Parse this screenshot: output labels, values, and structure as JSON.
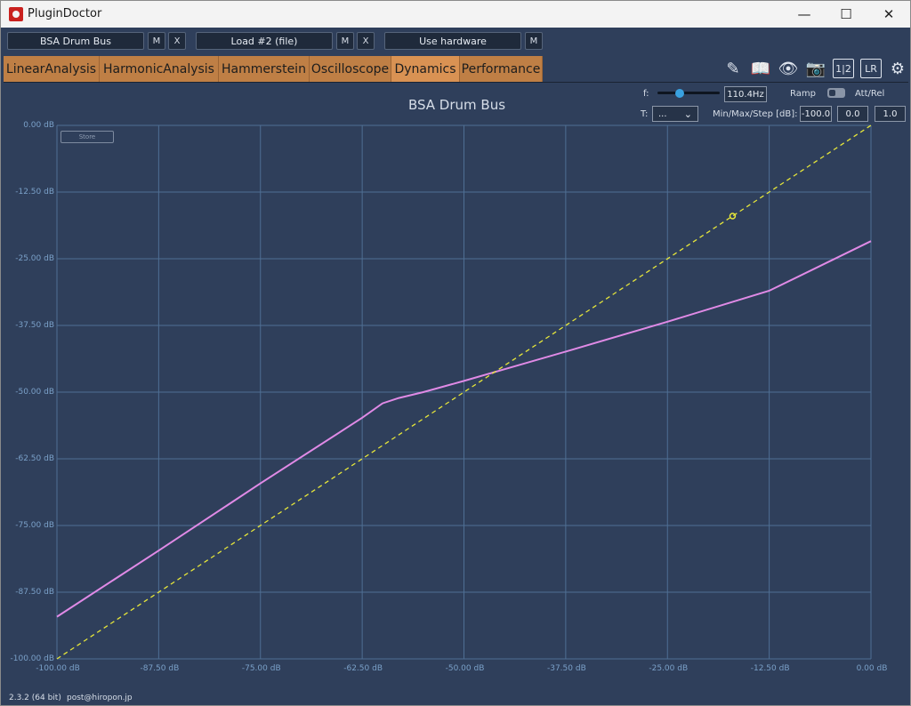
{
  "window": {
    "title": "PluginDoctor",
    "minimize": "—",
    "maximize": "☐",
    "close": "✕"
  },
  "toolbar": {
    "plugin_name": "BSA Drum Bus",
    "plugin_m": "M",
    "plugin_x": "X",
    "load_name": "Load #2 (file)",
    "load_m": "M",
    "load_x": "X",
    "hardware": "Use hardware",
    "hardware_m": "M"
  },
  "tabs": [
    "LinearAnalysis",
    "HarmonicAnalysis",
    "Hammerstein",
    "Oscilloscope",
    "Dynamics",
    "Performance"
  ],
  "active_tab": "Dynamics",
  "tool_icons": [
    "notes-icon",
    "book-icon",
    "eye-icon",
    "camera-icon",
    "split-12-icon",
    "lr-icon",
    "gear-icon"
  ],
  "tool_glyphs": [
    "✎",
    "📖",
    "👁",
    "📷",
    "1|2",
    "LR",
    "⚙"
  ],
  "controls": {
    "f_label": "f:",
    "f_value": "110.4Hz",
    "ramp_label": "Ramp",
    "attrel_label": "Att/Rel",
    "t_label": "T:",
    "t_value": "...",
    "minmax_label": "Min/Max/Step [dB]:",
    "min_value": "-100.0",
    "max_value": "0.0",
    "step_value": "1.0"
  },
  "store_label": "Store",
  "status": {
    "version": "2.3.2 (64 bit)",
    "email": "post@hiropon.jp"
  },
  "colors": {
    "background": "#2f3f5b",
    "grid": "#4f6f94",
    "curve": "#e08ae6",
    "reference": "#e6e63a",
    "tab": "#bf7f45"
  },
  "chart_data": {
    "type": "line",
    "title": "BSA Drum Bus",
    "xlim": [
      -100,
      0
    ],
    "ylim": [
      -100,
      0
    ],
    "x_ticks": [
      "-100.00 dB",
      "-87.50 dB",
      "-75.00 dB",
      "-62.50 dB",
      "-50.00 dB",
      "-37.50 dB",
      "-25.00 dB",
      "-12.50 dB",
      "0.00 dB"
    ],
    "y_ticks": [
      "0.00 dB",
      "-12.50 dB",
      "-25.00 dB",
      "-37.50 dB",
      "-50.00 dB",
      "-62.50 dB",
      "-75.00 dB",
      "-87.50 dB",
      "-100.00 dB"
    ],
    "grid": true,
    "series": [
      {
        "color": "#e08ae6",
        "style": "solid",
        "points": [
          [
            -100,
            -92.1
          ],
          [
            -87.5,
            -79.7
          ],
          [
            -75,
            -67.1
          ],
          [
            -62.5,
            -54.8
          ],
          [
            -60,
            -52.1
          ],
          [
            -58,
            -51.1
          ],
          [
            -55,
            -50.0
          ],
          [
            -50,
            -47.9
          ],
          [
            -45,
            -45.7
          ],
          [
            -37.5,
            -42.4
          ],
          [
            -25,
            -36.8
          ],
          [
            -12.5,
            -31.0
          ],
          [
            0,
            -21.7
          ]
        ]
      },
      {
        "color": "#e6e63a",
        "style": "dashed",
        "points": [
          [
            -100,
            -100
          ],
          [
            0,
            0
          ]
        ]
      }
    ],
    "marker": {
      "x": -17,
      "y": -17
    }
  }
}
